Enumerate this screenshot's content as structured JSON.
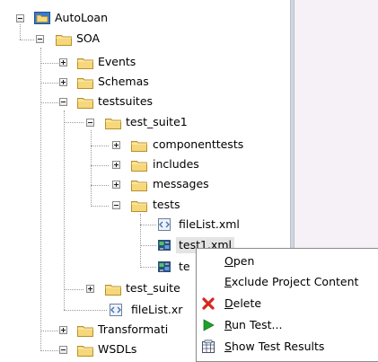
{
  "tree": {
    "root": "AutoLoan",
    "soa": "SOA",
    "events": "Events",
    "schemas": "Schemas",
    "testsuites": "testsuites",
    "test_suite1": "test_suite1",
    "componenttests": "componenttests",
    "includes": "includes",
    "messages": "messages",
    "tests": "tests",
    "file_list_tests": "fileList.xml",
    "test1_xml": "test1.xml",
    "test2_partial": "te",
    "test_suite2_partial": "test_suite",
    "file_list_suites_partial": "fileList.xr",
    "transformations_partial": "Transformati",
    "wsdls": "WSDLs"
  },
  "context_menu": {
    "items": [
      {
        "mnemonic": "O",
        "rest": "pen",
        "icon": ""
      },
      {
        "mnemonic": "E",
        "rest": "xclude Project Content",
        "icon": ""
      },
      {
        "mnemonic": "D",
        "rest": "elete",
        "icon": "delete-x-icon"
      },
      {
        "mnemonic": "R",
        "rest": "un Test...",
        "icon": "run-arrow-icon"
      },
      {
        "mnemonic": "S",
        "rest": "how Test Results",
        "icon": "test-results-icon"
      }
    ]
  },
  "colors": {
    "folder_fill": "#f6d77a",
    "folder_stroke": "#b8902a",
    "editor_background": "#f6f1f6",
    "delete_red": "#d7261e",
    "run_green": "#1fa02c",
    "selection_gray": "#e4e4e4"
  }
}
